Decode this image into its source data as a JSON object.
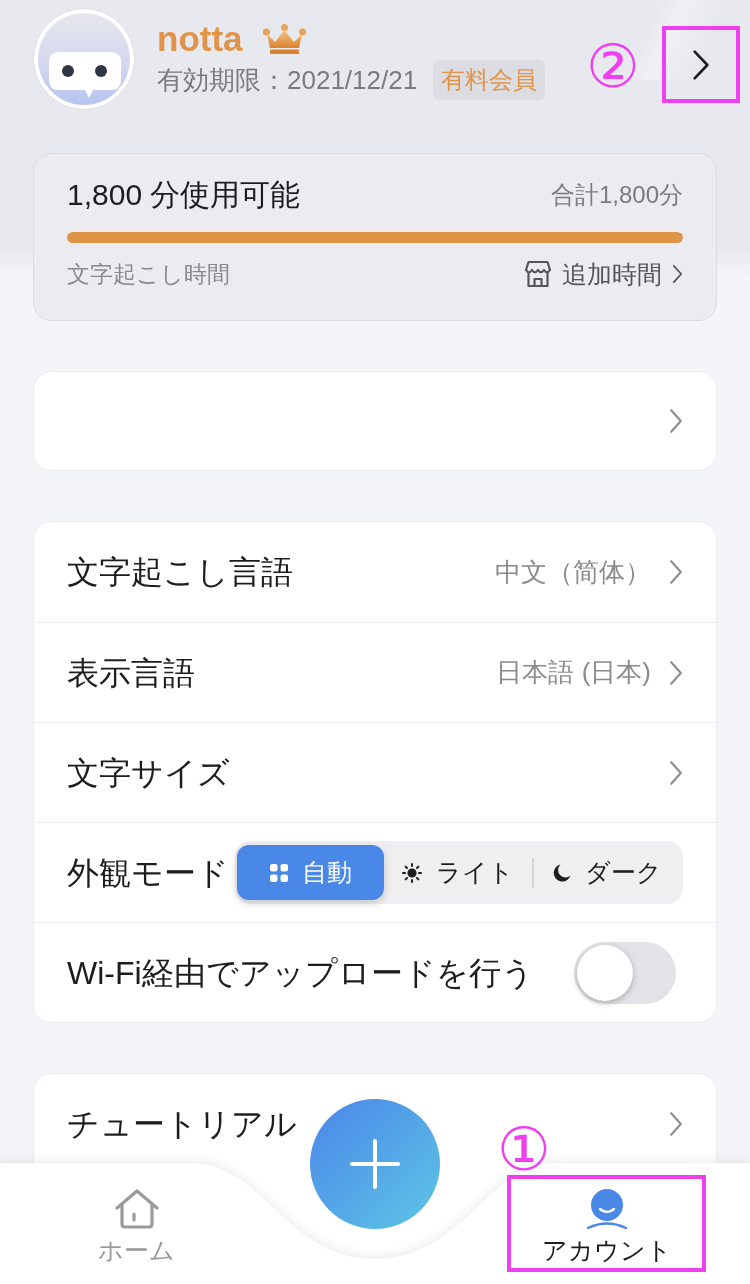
{
  "profile": {
    "name": "notta",
    "expiry": "有効期限：2021/12/21",
    "badge": "有料会員",
    "annotation": "②"
  },
  "usage": {
    "title": "1,800 分使用可能",
    "total": "合計1,800分",
    "level": 1,
    "caption": "文字起こし時間",
    "link": "追加時間"
  },
  "groups": [
    {
      "rows": [
        {
          "kind": "link"
        }
      ]
    },
    {
      "rows": [
        {
          "kind": "link",
          "label": "文字起こし言語",
          "value": "中文（简体）"
        },
        {
          "kind": "link",
          "label": "表示言語",
          "value": "日本語 (日本)"
        },
        {
          "kind": "link",
          "label": "文字サイズ"
        },
        {
          "kind": "segmented",
          "label": "外観モード",
          "options": [
            {
              "label": "自動",
              "selected": true
            },
            {
              "label": "ライト",
              "selected": false
            },
            {
              "label": "ダーク",
              "selected": false
            }
          ]
        },
        {
          "kind": "switch",
          "label": "Wi-Fi経由でアップロードを行う",
          "on": false
        }
      ]
    },
    {
      "rows": [
        {
          "kind": "link",
          "label": "チュートリアル"
        }
      ]
    }
  ],
  "tab_bar": {
    "tabs": [
      {
        "label": "ホーム",
        "selected": false
      },
      {
        "label": "アカウント",
        "selected": true,
        "annotation": "①"
      }
    ]
  }
}
